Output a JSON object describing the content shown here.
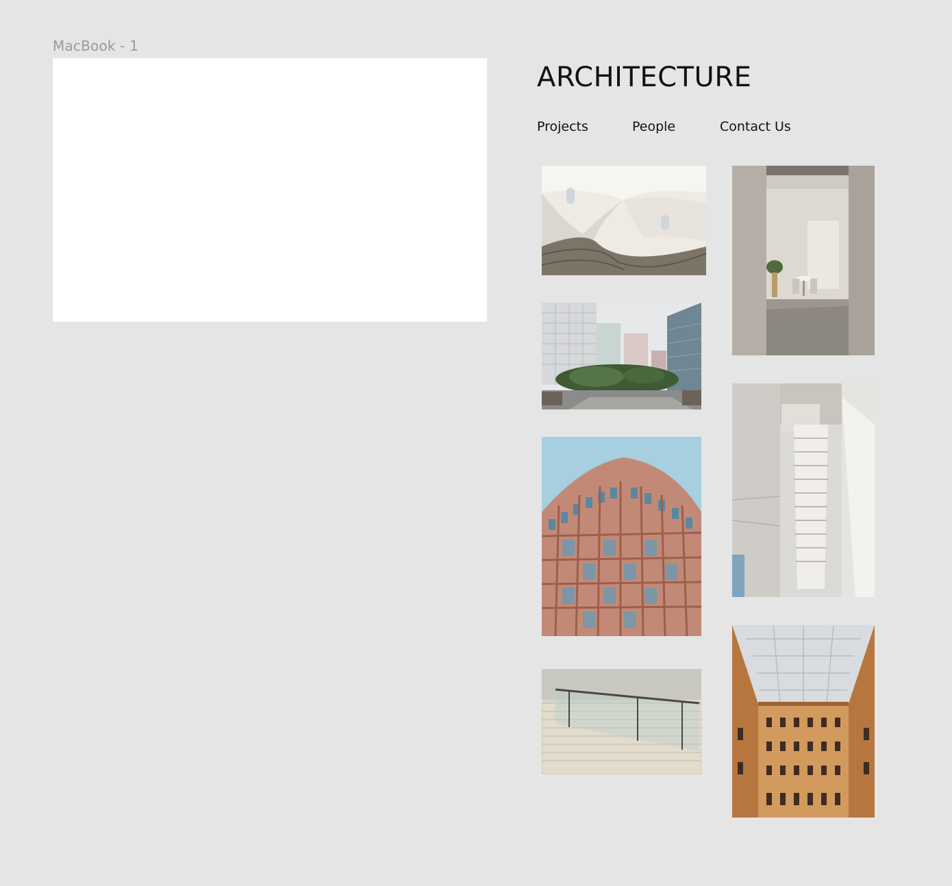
{
  "canvas": {
    "frame_label": "MacBook - 1"
  },
  "site": {
    "title": "ARCHITECTURE",
    "nav": {
      "projects": "Projects",
      "people": "People",
      "contact": "Contact Us"
    }
  },
  "gallery": {
    "images": [
      {
        "subject": "curved white tower interior with cobblestone ramp"
      },
      {
        "subject": "modern office towers with rooftop garden"
      },
      {
        "subject": "red brick facade high-rise against blue sky"
      },
      {
        "subject": "stone staircase with glass railing"
      },
      {
        "subject": "doorway into bright room with table and chairs"
      },
      {
        "subject": "looking up through white atrium with stairs"
      },
      {
        "subject": "ornate courtyard with glass skylight roof"
      }
    ]
  },
  "colors": {
    "background": "#e5e5e5",
    "artboard": "#ffffff",
    "text": "#111111",
    "label": "#9a9a9a"
  }
}
